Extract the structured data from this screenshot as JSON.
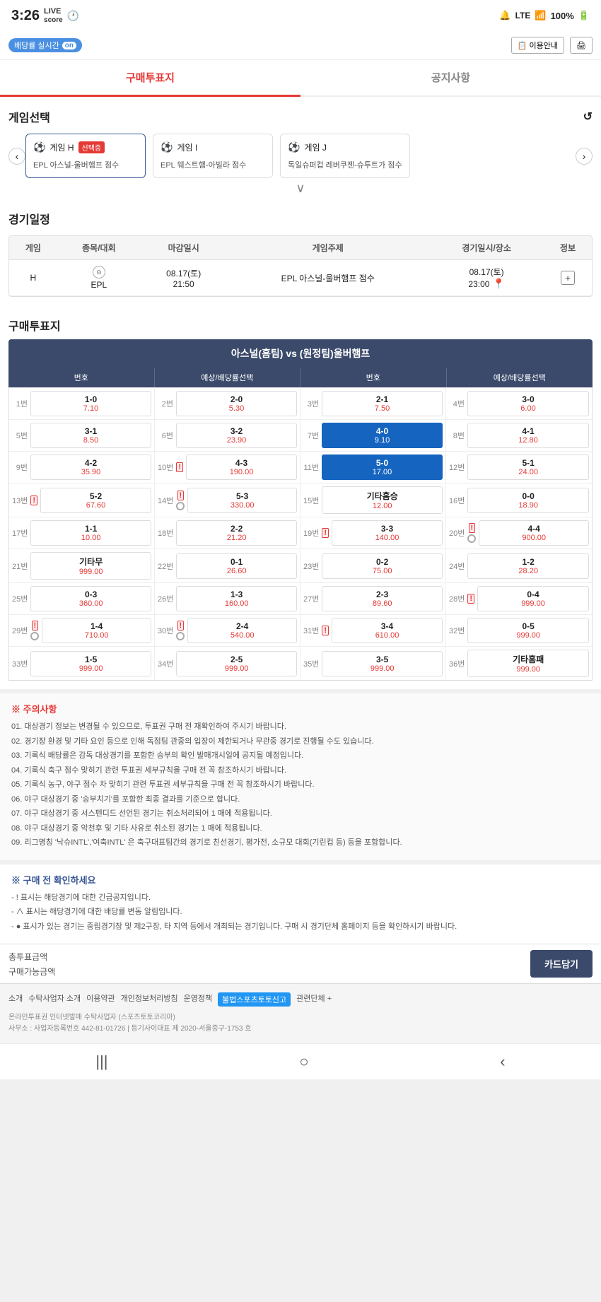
{
  "statusBar": {
    "time": "3:26",
    "liveLabel": "LIVE score",
    "battery": "100%",
    "signal": "LTE"
  },
  "topBar": {
    "liveText": "배당률 실시간",
    "onLabel": "on",
    "helpBtn": "이용안내",
    "printIcon": "🖨"
  },
  "tabs": [
    {
      "id": "purchase",
      "label": "구매투표지",
      "active": true
    },
    {
      "id": "notice",
      "label": "공지사항",
      "active": false
    }
  ],
  "gameSection": {
    "title": "게임선택",
    "refreshIcon": "↺",
    "games": [
      {
        "id": "H",
        "label": "게임 H",
        "selected": true,
        "badge": "선택중",
        "description": "EPL 아스널-울버햄프 점수"
      },
      {
        "id": "I",
        "label": "게임 I",
        "selected": false,
        "badge": "",
        "description": "EPL 웨스트햄-아빌라 점수"
      },
      {
        "id": "J",
        "label": "게임 J",
        "selected": false,
        "badge": "",
        "description": "독일슈퍼컵 레버쿠젠-슈투트가 점수"
      }
    ]
  },
  "schedule": {
    "title": "경기일정",
    "headers": [
      "게임",
      "종목/대회",
      "마감일시",
      "게임주제",
      "경기일시/장소",
      "정보"
    ],
    "rows": [
      {
        "game": "H",
        "sport": "EPL",
        "deadline": "08.17(토) 21:50",
        "subject": "EPL 아스널-울버햄프 점수",
        "datetime": "08.17(토) 23:00",
        "hasLocation": true
      }
    ]
  },
  "purchaseSection": {
    "title": "구매투표지",
    "matchTitle": "아스널(홈팀) vs (원정팀)울버햄프",
    "gridHeaders": [
      "번호",
      "예상/배당률선택",
      "번호",
      "예상/배당률선택",
      "번호",
      "예상/배당률선택",
      "번호",
      "예상/배당률선택"
    ],
    "bets": [
      {
        "num": "1번",
        "score": "1-0",
        "odds": "7.10",
        "selected": false,
        "urgent": false,
        "radio": false
      },
      {
        "num": "2번",
        "score": "2-0",
        "odds": "5.30",
        "selected": false,
        "urgent": false,
        "radio": false
      },
      {
        "num": "3번",
        "score": "2-1",
        "odds": "7.50",
        "selected": false,
        "urgent": false,
        "radio": false
      },
      {
        "num": "4번",
        "score": "3-0",
        "odds": "6.00",
        "selected": false,
        "urgent": false,
        "radio": false
      },
      {
        "num": "5번",
        "score": "3-1",
        "odds": "8.50",
        "selected": false,
        "urgent": false,
        "radio": false
      },
      {
        "num": "6번",
        "score": "3-2",
        "odds": "23.90",
        "selected": false,
        "urgent": false,
        "radio": false
      },
      {
        "num": "7번",
        "score": "4-0",
        "odds": "9.10",
        "selected": true,
        "urgent": false,
        "radio": false
      },
      {
        "num": "8번",
        "score": "4-1",
        "odds": "12.80",
        "selected": false,
        "urgent": false,
        "radio": false
      },
      {
        "num": "9번",
        "score": "4-2",
        "odds": "35.90",
        "selected": false,
        "urgent": false,
        "radio": false
      },
      {
        "num": "10번",
        "score": "4-3",
        "odds": "190.00",
        "selected": false,
        "urgent": true,
        "radio": false
      },
      {
        "num": "11번",
        "score": "5-0",
        "odds": "17.00",
        "selected": true,
        "urgent": false,
        "radio": false
      },
      {
        "num": "12번",
        "score": "5-1",
        "odds": "24.00",
        "selected": false,
        "urgent": false,
        "radio": false
      },
      {
        "num": "13번",
        "score": "5-2",
        "odds": "67.60",
        "selected": false,
        "urgent": true,
        "radio": false
      },
      {
        "num": "14번",
        "score": "5-3",
        "odds": "330.00",
        "selected": false,
        "urgent": true,
        "radio": true
      },
      {
        "num": "15번",
        "score": "기타홈승",
        "odds": "12.00",
        "selected": false,
        "urgent": false,
        "radio": false
      },
      {
        "num": "16번",
        "score": "0-0",
        "odds": "18.90",
        "selected": false,
        "urgent": false,
        "radio": false
      },
      {
        "num": "17번",
        "score": "1-1",
        "odds": "10.00",
        "selected": false,
        "urgent": false,
        "radio": false
      },
      {
        "num": "18번",
        "score": "2-2",
        "odds": "21.20",
        "selected": false,
        "urgent": false,
        "radio": false
      },
      {
        "num": "19번",
        "score": "3-3",
        "odds": "140.00",
        "selected": false,
        "urgent": true,
        "radio": false
      },
      {
        "num": "20번",
        "score": "4-4",
        "odds": "900.00",
        "selected": false,
        "urgent": true,
        "radio": true
      },
      {
        "num": "21번",
        "score": "기타무",
        "odds": "999.00",
        "selected": false,
        "urgent": false,
        "radio": false
      },
      {
        "num": "22번",
        "score": "0-1",
        "odds": "26.60",
        "selected": false,
        "urgent": false,
        "radio": false
      },
      {
        "num": "23번",
        "score": "0-2",
        "odds": "75.00",
        "selected": false,
        "urgent": false,
        "radio": false
      },
      {
        "num": "24번",
        "score": "1-2",
        "odds": "28.20",
        "selected": false,
        "urgent": false,
        "radio": false
      },
      {
        "num": "25번",
        "score": "0-3",
        "odds": "360.00",
        "selected": false,
        "urgent": false,
        "radio": false
      },
      {
        "num": "26번",
        "score": "1-3",
        "odds": "160.00",
        "selected": false,
        "urgent": false,
        "radio": false
      },
      {
        "num": "27번",
        "score": "2-3",
        "odds": "89.60",
        "selected": false,
        "urgent": false,
        "radio": false
      },
      {
        "num": "28번",
        "score": "0-4",
        "odds": "999.00",
        "selected": false,
        "urgent": true,
        "radio": false
      },
      {
        "num": "29번",
        "score": "1-4",
        "odds": "710.00",
        "selected": false,
        "urgent": true,
        "radio": true
      },
      {
        "num": "30번",
        "score": "2-4",
        "odds": "540.00",
        "selected": false,
        "urgent": true,
        "radio": true
      },
      {
        "num": "31번",
        "score": "3-4",
        "odds": "610.00",
        "selected": false,
        "urgent": true,
        "radio": false
      },
      {
        "num": "32번",
        "score": "0-5",
        "odds": "999.00",
        "selected": false,
        "urgent": false,
        "radio": false
      },
      {
        "num": "33번",
        "score": "1-5",
        "odds": "999.00",
        "selected": false,
        "urgent": false,
        "radio": false
      },
      {
        "num": "34번",
        "score": "2-5",
        "odds": "999.00",
        "selected": false,
        "urgent": false,
        "radio": false
      },
      {
        "num": "35번",
        "score": "3-5",
        "odds": "999.00",
        "selected": false,
        "urgent": false,
        "radio": false
      },
      {
        "num": "36번",
        "score": "기타홈패",
        "odds": "999.00",
        "selected": false,
        "urgent": false,
        "radio": false
      }
    ]
  },
  "notes": {
    "title": "※ 주의사항",
    "items": [
      "01. 대상경기 정보는 변경될 수 있으므로, 투표권 구매 전 재확인하여 주시기 바랍니다.",
      "02. 경기장 환경 및 기타 요인 등으로 인해 독점팀 관중의 입장이 제한되거나 무관중 경기로 진행될 수도 있습니다.",
      "03. 기록식 배당률은 감독 대상경기를 포함한 승부의 확인 발매개시일에 공지될 예정입니다.",
      "04. 기록식 축구 점수 맞히기 관련 투표권 세부규칙을 구매 전 꼭 참조하시기 바랍니다.",
      "05. 기록식 농구, 야구 점수 차 맞히기 관련 투표권 세부규칙을 구매 전 꼭 참조하시기 바랍니다.",
      "06. 야구 대상경기 중 '승부치기'를 포함한 최종 결과를 기준으로 합니다.",
      "07. 야구 대상경기 중 서스펜디드 선언된 경기는 취소처리되어 1 매에 적용됩니다.",
      "08. 야구 대상경기 중 악천후 및 기타 사유로 취소된 경기는 1 매에 적용됩니다.",
      "09. 리그명칭 '낙슈INTL','여축INTL' 은 축구대표팀간의 경기로 친선경기, 평가전, 소규모 대회(기린컵 등) 등을 포함합니다."
    ]
  },
  "purchaseCheck": {
    "title": "※ 구매 전 확인하세요",
    "items": [
      "! 표시는 해당경기에 대한 긴급공지입니다.",
      "∧ 표시는 해당경기에 대한 배당률 변동 알림입니다.",
      "● 표시가 있는 경기는 중립경기장 및 제2구장, 타 지역 등에서 개최되는 경기입니다. 구매 시 경기단체 홈페이지 등을 확인하시기 바랍니다."
    ]
  },
  "amountBar": {
    "totalLabel": "총투표금액",
    "availableLabel": "구매가능금액",
    "cardBtn": "카드담기"
  },
  "footer": {
    "links": [
      "소개",
      "수탁사업자 소개",
      "이용약관",
      "개인정보처리방침",
      "운영정책",
      "불법스포츠토토신고",
      "관련단체 +"
    ],
    "highlightLink": "불법스포츠토토신고",
    "text1": "온라인투표권 인터넷발매 수탁사업자 (스포츠토토코리아)",
    "text2": "사무소 : 사업자등록번호 442-81-01726 | 등기사이대표 제 2020-서울중구-1753 호"
  },
  "bottomNav": {
    "icons": [
      "|||",
      "○",
      "〈"
    ]
  }
}
